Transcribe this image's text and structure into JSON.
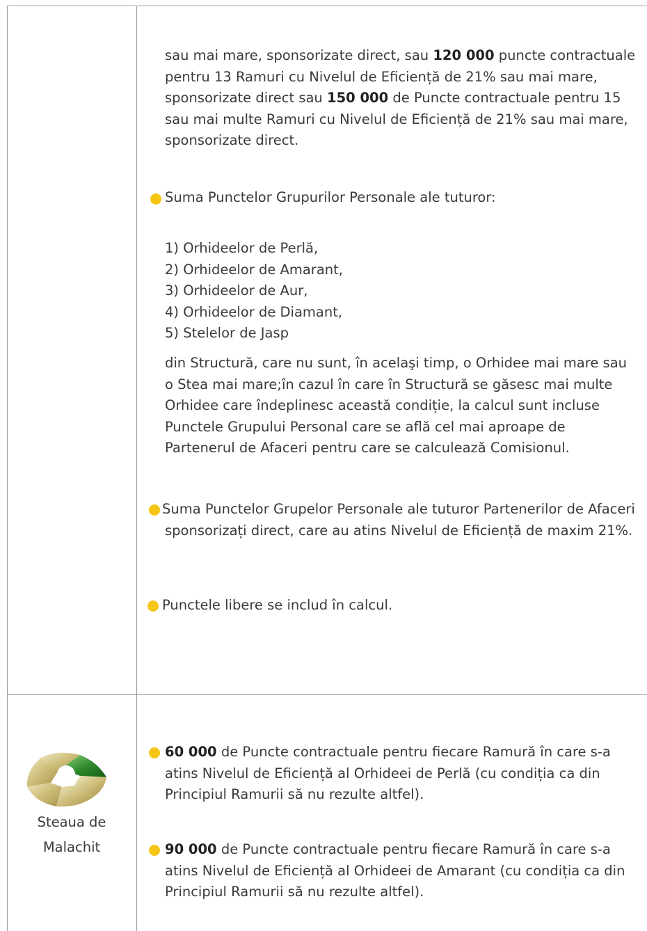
{
  "top_continuation": {
    "segments": [
      {
        "t": "sau mai mare, sponsorizate direct, sau ",
        "b": false
      },
      {
        "t": "120 000",
        "b": true
      },
      {
        "t": " puncte contractuale pentru 13 Ramuri cu Nivelul de Eficiență de 21% sau mai mare, sponsorizate direct sau ",
        "b": false
      },
      {
        "t": "150 000",
        "b": true
      },
      {
        "t": " de Puncte contractuale pentru 15 sau mai multe Ramuri cu Nivelul de Eficiență de 21% sau mai mare, sponsorizate direct.",
        "b": false
      }
    ]
  },
  "bullet_points_sum": {
    "text": "Suma Punctelor Grupurilor Personale ale tuturor:",
    "items": [
      "1) Orhideelor de Perlă,",
      "2) Orhideelor de Amarant,",
      "3) Orhideelor de Aur,",
      "4) Orhideelor de Diamant,",
      "5) Stelelor de Jasp"
    ],
    "after": "din Structură, care nu sunt, în acelaşi timp, o Orhidee mai mare sau o Stea mai mare;în cazul în care în Structură se găsesc mai multe Orhidee care îndeplinesc această condiție, la calcul sunt incluse Punctele Grupului Personal care se află cel mai aproape de Partenerul de Afaceri pentru care se calculează Comisionul."
  },
  "bullet_partners": {
    "text": "Suma Punctelor Grupelor Personale ale tuturor Partenerilor de Afaceri sponsorizați direct, care au atins Nivelul de Eficiență de maxim 21%."
  },
  "bullet_free_points": {
    "text": "Punctele libere se includ în calcul."
  },
  "rank": {
    "name_line1": "Steaua de",
    "name_line2": "Malachit",
    "bullets": [
      {
        "value": "60 000",
        "text": " de Puncte contractuale pentru fiecare Ramură în care s-a atins Nivelul de Eficiență al Orhideei de Perlă (cu condiția ca din Principiul Ramurii să nu rezulte altfel)."
      },
      {
        "value": "90 000",
        "text": " de Puncte contractuale pentru fiecare Ramură în care s-a atins Nivelul de Eficiență al Orhideei de Amarant (cu condiția ca din Principiul Ramurii să nu rezulte altfel)."
      }
    ]
  },
  "colors": {
    "bullet": "#f6c617",
    "border": "#9a9a9a",
    "logo_gold": "#cdbd7a",
    "logo_green": "#2f8a2c"
  }
}
